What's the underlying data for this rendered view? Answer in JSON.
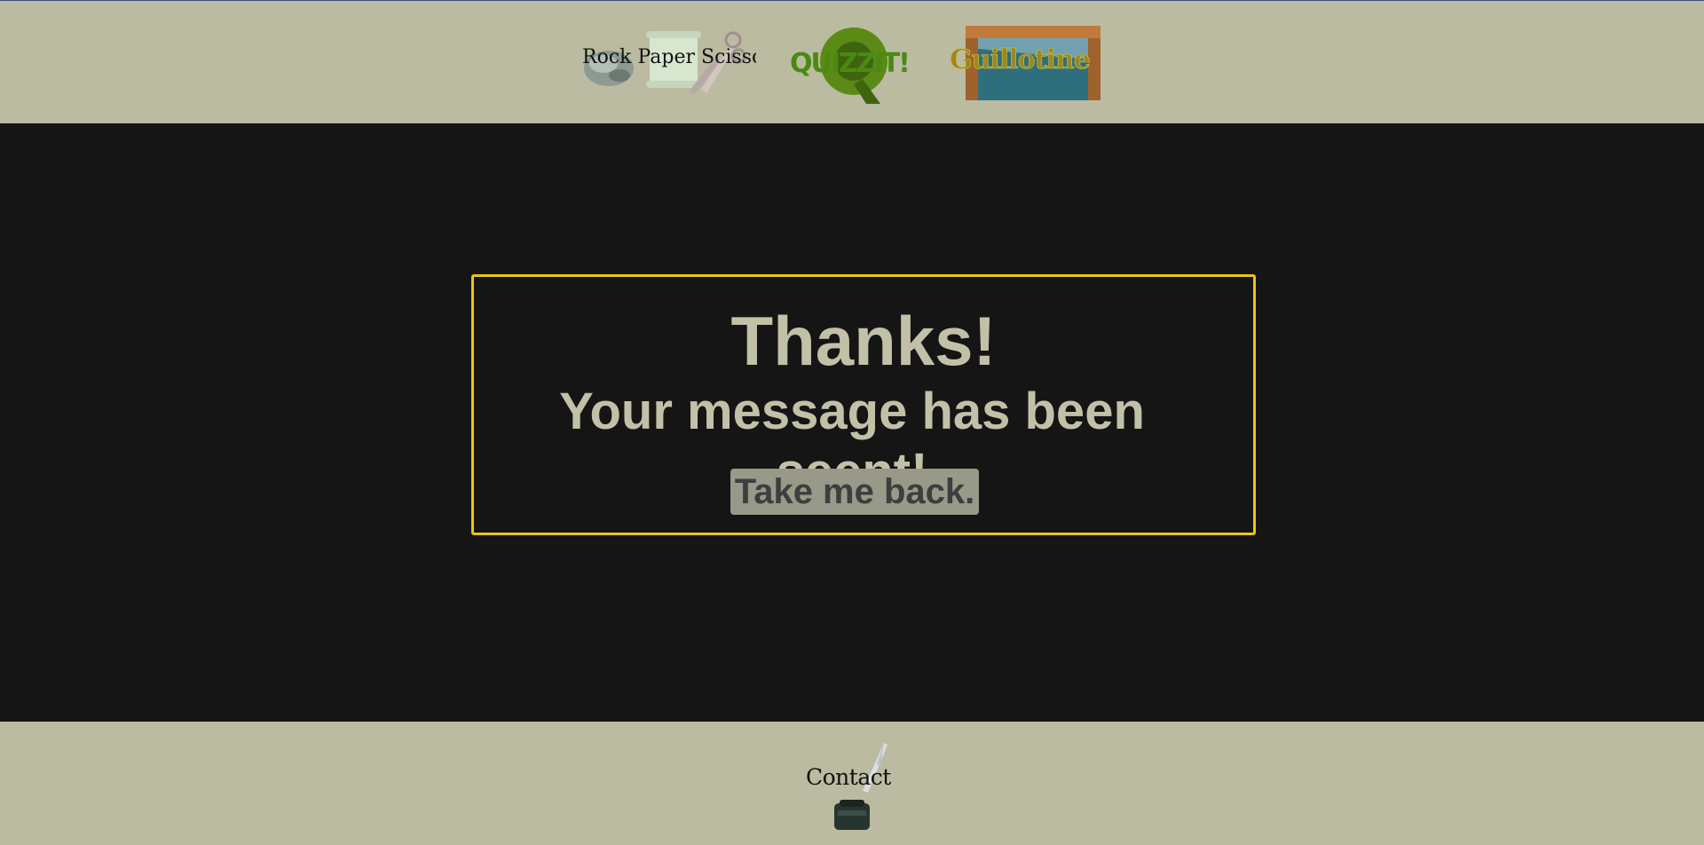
{
  "nav": {
    "rock_paper_scissors": "Rock Paper Scissors",
    "quizzit": "QUIZZIT!",
    "guillotine": "Guillotine"
  },
  "message": {
    "title": "Thanks!",
    "subtitle": "Your message has been seent!",
    "back_button": "Take me back."
  },
  "footer": {
    "contact": "Contact"
  },
  "colors": {
    "bar_bg": "#bbbba1",
    "main_bg": "#151515",
    "card_border": "#e8c51a",
    "text": "#c2c1a8",
    "button_bg": "#99998a",
    "button_text": "#3e3e3e"
  }
}
